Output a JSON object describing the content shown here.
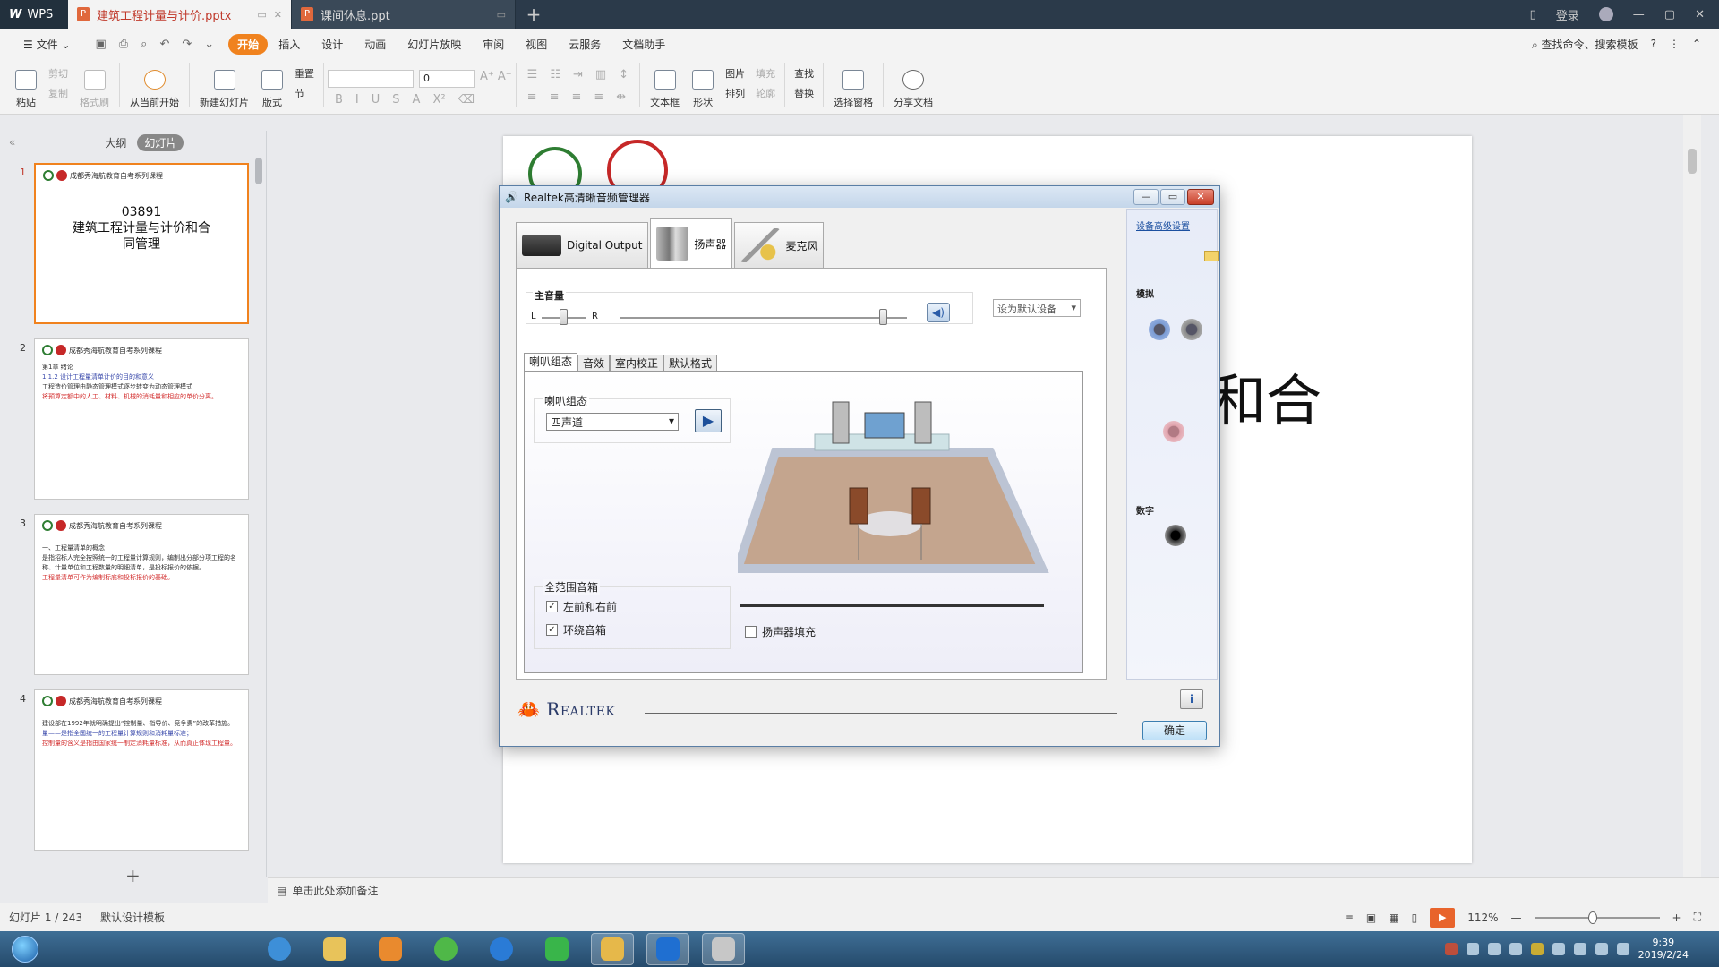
{
  "tabbar": {
    "app": "WPS",
    "tabs": [
      {
        "title": "建筑工程计量与计价.pptx",
        "active": true
      },
      {
        "title": "课间休息.ppt",
        "active": false
      }
    ],
    "login": "登录"
  },
  "menubar": {
    "file": "文件",
    "items": [
      "开始",
      "插入",
      "设计",
      "动画",
      "幻灯片放映",
      "审阅",
      "视图",
      "云服务",
      "文档助手"
    ],
    "search": "查找命令、搜索模板"
  },
  "ribbon": {
    "paste": "粘贴",
    "cut": "剪切",
    "copy": "复制",
    "format_painter": "格式刷",
    "from_current": "从当前开始",
    "new_slide": "新建幻灯片",
    "layout": "版式",
    "reset": "重置",
    "section": "节",
    "font_size": "0",
    "textbox": "文本框",
    "shape": "形状",
    "picture": "图片",
    "fill": "填充",
    "arrange": "排列",
    "outline": "轮廓",
    "find": "查找",
    "replace": "替换",
    "select_pane": "选择窗格",
    "share": "分享文档"
  },
  "leftpanel": {
    "tabs": [
      "大纲",
      "幻灯片"
    ],
    "header_text": "成都秀海航教育自考系列课程",
    "slides": [
      {
        "num": "1",
        "code": "03891",
        "title": "建筑工程计量与计价和合同管理"
      },
      {
        "num": "2",
        "line1": "第1章 绪论",
        "line2": "1.1.2 设计工程量清单计价的目的和意义",
        "line3": "工程造价管理由静态管理模式逐步转变为动态管理模式",
        "line4": "将预算定额中的人工、材料、机械的消耗量和相应的单价分离。"
      },
      {
        "num": "3",
        "line1": "一、工程量清单的概念",
        "line2": "是指招标人完全按照统一的工程量计算规则，编制出分部分项工程的名称、计量单位和工程数量的明细清单，是投标报价的依据。",
        "line3": "工程量清单可作为编制标底和投标报价的基础。"
      },
      {
        "num": "4",
        "line1": "建设部在1992年就明确提出“控制量、指导价、竞争费”的改革措施。",
        "line2": "量——是指全国统一的工程量计算规则和消耗量标准；",
        "line3": "控制量的含义是指由国家统一制定消耗量标准，从而真正体现工程量。"
      }
    ]
  },
  "slide": {
    "big_text": "和合"
  },
  "notes": {
    "placeholder": "单击此处添加备注"
  },
  "statusbar": {
    "slide_pos": "幻灯片 1 / 243",
    "template": "默认设计模板",
    "zoom": "112%",
    "zoom_level": 0.47
  },
  "taskbar": {
    "time": "9:39",
    "date": "2019/2/24"
  },
  "dialog": {
    "title": "Realtek高清晰音频管理器",
    "device_tabs": [
      "Digital Output",
      "扬声器",
      "麦克风"
    ],
    "main_volume_label": "主音量",
    "left": "L",
    "right": "R",
    "balance": 0.5,
    "volume": 0.92,
    "default_device": "设为默认设备",
    "sub_tabs": [
      "喇叭组态",
      "音效",
      "室内校正",
      "默认格式"
    ],
    "speaker_config_label": "喇叭组态",
    "speaker_config_value": "四声道",
    "fullrange_label": "全范围音箱",
    "front_lr": "左前和右前",
    "surround": "环绕音箱",
    "speaker_fill": "扬声器填充",
    "advanced_link": "设备高级设置",
    "analog": "模拟",
    "digital": "数字",
    "brand": "Realtek",
    "ok": "确定"
  }
}
